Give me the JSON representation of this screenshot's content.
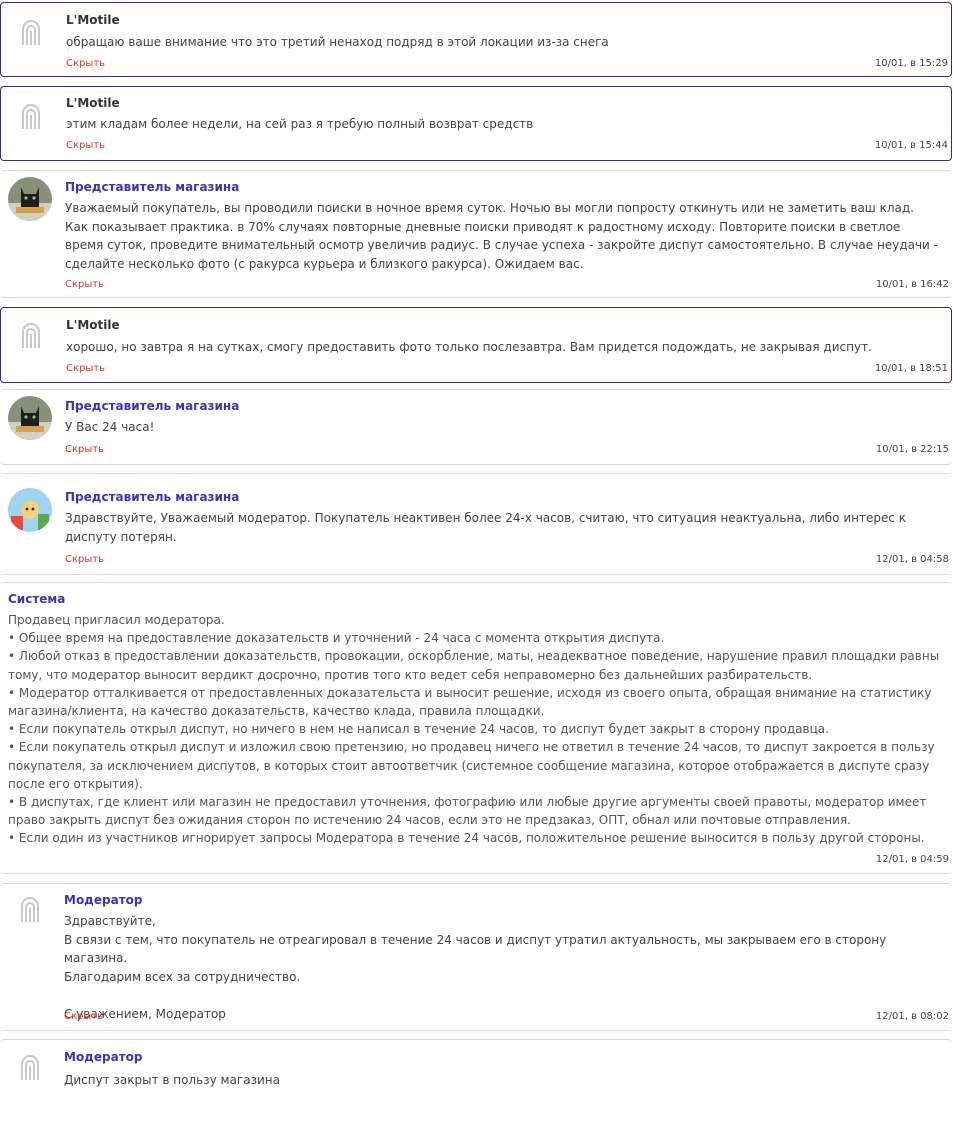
{
  "messages": [
    {
      "author": "L'Motile",
      "text": "обращаю ваше внимание что это третий ненаход подряд в этой локации из-за снега",
      "hide": "Скрыть",
      "time": "10/01, в 15:29"
    },
    {
      "author": "L'Motile",
      "text": "этим кладам более недели, на сей раз я требую полный возврат средств",
      "hide": "Скрыть",
      "time": "10/01, в 15:44"
    },
    {
      "author": "Представитель магазина",
      "text": "Уважаемый покупатель, вы проводили поиски в ночное время суток. Ночью вы могли попросту откинуть или не заметить ваш клад. Как показывает практика. в 70% случаях повторные дневные поиски приводят к радостному исходу. Повторите поиски в светлое время суток, проведите внимательный осмотр увеличив радиус. В случае успеха - закройте диспут самостоятельно. В случае неудачи - сделайте несколько фото (с ракурса курьера и близкого ракурса). Ожидаем вас.",
      "hide": "Скрыть",
      "time": "10/01, в 16:42"
    },
    {
      "author": "L'Motile",
      "text": "хорошо, но завтра я на сутках, смогу предоставить фото только послезавтра. Вам придется подождать, не закрывая диспут.",
      "hide": "Скрыть",
      "time": "10/01, в 18:51"
    },
    {
      "author": "Представитель магазина",
      "text": "У Вас 24 часа!",
      "hide": "Скрыть",
      "time": "10/01, в 22:15"
    },
    {
      "author": "Представитель магазина",
      "text": "Здравствуйте, Уважаемый модератор. Покупатель неактивен более 24-х часов, считаю, что ситуация неактуальна, либо интерес к диспуту потерян.",
      "hide": "Скрыть",
      "time": "12/01, в 04:58"
    }
  ],
  "system": {
    "author": "Система",
    "lines": [
      "Продавец пригласил модератора.",
      "• Общее время на предоставление доказательств и уточнений - 24 часа с момента открытия диспута.",
      "• Любой отказ в предоставлении доказательств, провокации, оскорбление, маты, неадекватное поведение, нарушение правил площадки равны тому, что модератор выносит вердикт досрочно, против того кто ведет себя неправомерно без дальнейших разбирательств.",
      "• Модератор отталкивается от предоставленных доказательста и выносит решение, исходя из своего опыта, обращая внимание на статистику магазина/клиента, на качество доказательств, качество клада, правила площадки.",
      "• Если покупатель открыл диспут, но ничего в нем не написал в течение 24 часов, то диспут будет закрыт в сторону продавца.",
      "• Если покупатель открыл диспут и изложил свою претензию, но продавец ничего не ответил в течение 24 часов, то диспут закроется в пользу покупателя, за исключением диспутов, в которых стоит автоответчик (системное сообщение магазина, которое отображается в диспуте сразу после его открытия).",
      "• В диспутах, где клиент или магазин не предоставил уточнения, фотографию или любые другие аргументы своей правоты, модератор имеет право закрыть диспут без ожидания сторон по истечению 24 часов, если это не предзаказ, ОПТ, обнал или почтовые отправления.",
      "• Если один из участников игнорирует запросы Модератора в течение 24 часов, положительное решение выносится в пользу другой стороны."
    ],
    "time": "12/01, в 04:59"
  },
  "moderator1": {
    "author": "Модератор",
    "line1": "Здравствуйте,",
    "line2": "В связи с тем, что покупатель не отреагировал в течение 24 часов и диспут утратил актуальность, мы закрываем его в сторону магазина.",
    "line3": "Благодарим всех за сотрудничество.",
    "line4": "С уважением, Модератор",
    "hide": "Скрыть",
    "time": "12/01, в 08:02"
  },
  "moderator2": {
    "author": "Модератор",
    "text": "Диспут закрыт в пользу магазина"
  },
  "colors": {
    "accent": "#3c35b5",
    "hide": "#e0322b",
    "highlight_border": "#2a2a9a"
  },
  "icons": {
    "user_avatar": "brand-logo-icon",
    "shop_avatar": "cat-avatar",
    "shop_avatar_alt": "cartoon-avatar"
  }
}
